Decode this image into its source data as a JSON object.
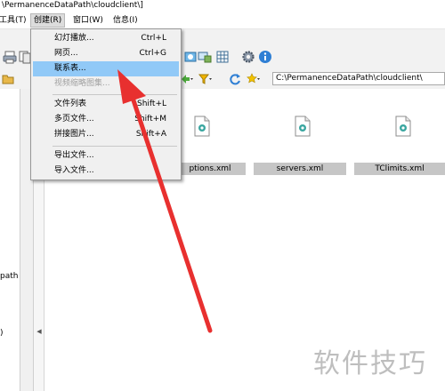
{
  "window": {
    "title": "\\PermanenceDataPath\\cloudclient\\]"
  },
  "menubar": {
    "items": [
      {
        "label": "工具(T)"
      },
      {
        "label": "创建(R)"
      },
      {
        "label": "窗口(W)"
      },
      {
        "label": "信息(I)"
      }
    ]
  },
  "create_menu": {
    "items": [
      {
        "label": "幻灯播放...",
        "shortcut": "Ctrl+L"
      },
      {
        "label": "网页...",
        "shortcut": "Ctrl+G"
      },
      {
        "label": "联系表...",
        "shortcut": ""
      },
      {
        "label": "视频缩略图集...",
        "shortcut": ""
      },
      {
        "label": "文件列表",
        "shortcut": "Shift+L"
      },
      {
        "label": "多页文件...",
        "shortcut": "Shift+M"
      },
      {
        "label": "拼接图片...",
        "shortcut": "Shift+A"
      },
      {
        "label": "导出文件...",
        "shortcut": ""
      },
      {
        "label": "导入文件...",
        "shortcut": ""
      }
    ],
    "highlighted_index": 2,
    "disabled_index": 3
  },
  "address_bar": {
    "path": "C:\\PermanenceDataPath\\cloudclient\\"
  },
  "left_pane": {
    "fragments": [
      "path",
      ")"
    ]
  },
  "files": [
    {
      "name": "options.xml",
      "display": "ptions.xml"
    },
    {
      "name": "servers.xml",
      "display": "servers.xml"
    },
    {
      "name": "TClimits.xml",
      "display": "TClimits.xml"
    }
  ],
  "watermark": {
    "text": "软件技巧"
  },
  "colors": {
    "highlight": "#91c9f7",
    "arrow": "#e8302f",
    "label_bg": "#c6c6c6"
  }
}
